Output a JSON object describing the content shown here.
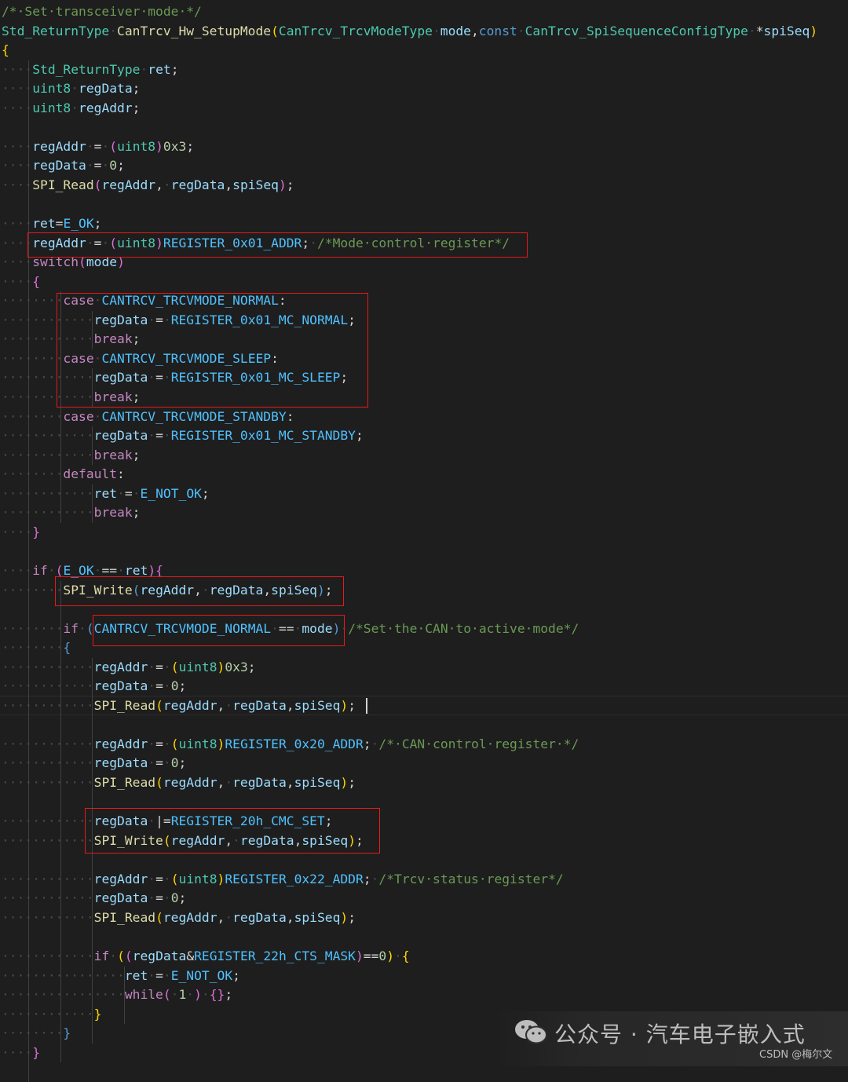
{
  "editor": {
    "language": "c",
    "lines": [
      [
        [
          "cm",
          "/*·Set·transceiver·mode·*/"
        ]
      ],
      [
        [
          "ty",
          "Std_ReturnType"
        ],
        [
          "ws",
          "·"
        ],
        [
          "fn",
          "CanTrcv_Hw_SetupMode"
        ],
        [
          "br",
          "("
        ],
        [
          "ty",
          "CanTrcv_TrcvModeType"
        ],
        [
          "ws",
          "·"
        ],
        [
          "vr",
          "mode"
        ],
        [
          "op",
          ","
        ],
        [
          "kw",
          "const"
        ],
        [
          "ws",
          "·"
        ],
        [
          "ty",
          "CanTrcv_SpiSequenceConfigType"
        ],
        [
          "ws",
          "·"
        ],
        [
          "op",
          "*"
        ],
        [
          "vr",
          "spiSeq"
        ],
        [
          "br",
          ")"
        ]
      ],
      [
        [
          "br",
          "{"
        ]
      ],
      [
        [
          "ws",
          "····"
        ],
        [
          "ty",
          "Std_ReturnType"
        ],
        [
          "ws",
          "·"
        ],
        [
          "vr",
          "ret"
        ],
        [
          "op",
          ";"
        ]
      ],
      [
        [
          "ws",
          "····"
        ],
        [
          "ty",
          "uint8"
        ],
        [
          "ws",
          "·"
        ],
        [
          "vr",
          "regData"
        ],
        [
          "op",
          ";"
        ]
      ],
      [
        [
          "ws",
          "····"
        ],
        [
          "ty",
          "uint8"
        ],
        [
          "ws",
          "·"
        ],
        [
          "vr",
          "regAddr"
        ],
        [
          "op",
          ";"
        ]
      ],
      [],
      [
        [
          "ws",
          "····"
        ],
        [
          "vr",
          "regAddr"
        ],
        [
          "ws",
          "·"
        ],
        [
          "op",
          "="
        ],
        [
          "ws",
          "·"
        ],
        [
          "pk",
          "("
        ],
        [
          "ty",
          "uint8"
        ],
        [
          "pk",
          ")"
        ],
        [
          "nm",
          "0x3"
        ],
        [
          "op",
          ";"
        ]
      ],
      [
        [
          "ws",
          "····"
        ],
        [
          "vr",
          "regData"
        ],
        [
          "ws",
          "·"
        ],
        [
          "op",
          "="
        ],
        [
          "ws",
          "·"
        ],
        [
          "nm",
          "0"
        ],
        [
          "op",
          ";"
        ]
      ],
      [
        [
          "ws",
          "····"
        ],
        [
          "fn",
          "SPI_Read"
        ],
        [
          "pk",
          "("
        ],
        [
          "vr",
          "regAddr"
        ],
        [
          "op",
          ","
        ],
        [
          "ws",
          "·"
        ],
        [
          "vr",
          "regData"
        ],
        [
          "op",
          ","
        ],
        [
          "vr",
          "spiSeq"
        ],
        [
          "pk",
          ")"
        ],
        [
          "op",
          ";"
        ]
      ],
      [],
      [
        [
          "ws",
          "····"
        ],
        [
          "vr",
          "ret"
        ],
        [
          "op",
          "="
        ],
        [
          "mc",
          "E_OK"
        ],
        [
          "op",
          ";"
        ]
      ],
      [
        [
          "ws",
          "····"
        ],
        [
          "vr",
          "regAddr"
        ],
        [
          "ws",
          "·"
        ],
        [
          "op",
          "="
        ],
        [
          "ws",
          "·"
        ],
        [
          "pk",
          "("
        ],
        [
          "ty",
          "uint8"
        ],
        [
          "pk",
          ")"
        ],
        [
          "mc",
          "REGISTER_0x01_ADDR"
        ],
        [
          "op",
          ";"
        ],
        [
          "ws",
          "·"
        ],
        [
          "cm",
          "/*Mode·control·register*/"
        ]
      ],
      [
        [
          "ws",
          "····"
        ],
        [
          "ct",
          "switch"
        ],
        [
          "pk",
          "("
        ],
        [
          "vr",
          "mode"
        ],
        [
          "pk",
          ")"
        ]
      ],
      [
        [
          "ws",
          "····"
        ],
        [
          "pk",
          "{"
        ]
      ],
      [
        [
          "ws",
          "········"
        ],
        [
          "ct",
          "case"
        ],
        [
          "ws",
          "·"
        ],
        [
          "mc",
          "CANTRCV_TRCVMODE_NORMAL"
        ],
        [
          "op",
          ":"
        ]
      ],
      [
        [
          "ws",
          "············"
        ],
        [
          "vr",
          "regData"
        ],
        [
          "ws",
          "·"
        ],
        [
          "op",
          "="
        ],
        [
          "ws",
          "·"
        ],
        [
          "mc",
          "REGISTER_0x01_MC_NORMAL"
        ],
        [
          "op",
          ";"
        ]
      ],
      [
        [
          "ws",
          "············"
        ],
        [
          "ct",
          "break"
        ],
        [
          "op",
          ";"
        ]
      ],
      [
        [
          "ws",
          "········"
        ],
        [
          "ct",
          "case"
        ],
        [
          "ws",
          "·"
        ],
        [
          "mc",
          "CANTRCV_TRCVMODE_SLEEP"
        ],
        [
          "op",
          ":"
        ]
      ],
      [
        [
          "ws",
          "············"
        ],
        [
          "vr",
          "regData"
        ],
        [
          "ws",
          "·"
        ],
        [
          "op",
          "="
        ],
        [
          "ws",
          "·"
        ],
        [
          "mc",
          "REGISTER_0x01_MC_SLEEP"
        ],
        [
          "op",
          ";"
        ]
      ],
      [
        [
          "ws",
          "············"
        ],
        [
          "ct",
          "break"
        ],
        [
          "op",
          ";"
        ]
      ],
      [
        [
          "ws",
          "········"
        ],
        [
          "ct",
          "case"
        ],
        [
          "ws",
          "·"
        ],
        [
          "mc",
          "CANTRCV_TRCVMODE_STANDBY"
        ],
        [
          "op",
          ":"
        ]
      ],
      [
        [
          "ws",
          "············"
        ],
        [
          "vr",
          "regData"
        ],
        [
          "ws",
          "·"
        ],
        [
          "op",
          "="
        ],
        [
          "ws",
          "·"
        ],
        [
          "mc",
          "REGISTER_0x01_MC_STANDBY"
        ],
        [
          "op",
          ";"
        ]
      ],
      [
        [
          "ws",
          "············"
        ],
        [
          "ct",
          "break"
        ],
        [
          "op",
          ";"
        ]
      ],
      [
        [
          "ws",
          "········"
        ],
        [
          "ct",
          "default"
        ],
        [
          "op",
          ":"
        ]
      ],
      [
        [
          "ws",
          "············"
        ],
        [
          "vr",
          "ret"
        ],
        [
          "ws",
          "·"
        ],
        [
          "op",
          "="
        ],
        [
          "ws",
          "·"
        ],
        [
          "mc",
          "E_NOT_OK"
        ],
        [
          "op",
          ";"
        ]
      ],
      [
        [
          "ws",
          "············"
        ],
        [
          "ct",
          "break"
        ],
        [
          "op",
          ";"
        ]
      ],
      [
        [
          "ws",
          "····"
        ],
        [
          "pk",
          "}"
        ]
      ],
      [],
      [
        [
          "ws",
          "····"
        ],
        [
          "ct",
          "if"
        ],
        [
          "ws",
          "·"
        ],
        [
          "pk",
          "("
        ],
        [
          "mc",
          "E_OK"
        ],
        [
          "ws",
          "·"
        ],
        [
          "op",
          "=="
        ],
        [
          "ws",
          "·"
        ],
        [
          "vr",
          "ret"
        ],
        [
          "pk",
          ")"
        ],
        [
          "pk",
          "{"
        ]
      ],
      [
        [
          "ws",
          "········"
        ],
        [
          "fn",
          "SPI_Write"
        ],
        [
          "kw",
          "("
        ],
        [
          "vr",
          "regAddr"
        ],
        [
          "op",
          ","
        ],
        [
          "ws",
          "·"
        ],
        [
          "vr",
          "regData"
        ],
        [
          "op",
          ","
        ],
        [
          "vr",
          "spiSeq"
        ],
        [
          "kw",
          ")"
        ],
        [
          "op",
          ";"
        ]
      ],
      [],
      [
        [
          "ws",
          "········"
        ],
        [
          "ct",
          "if"
        ],
        [
          "ws",
          "·"
        ],
        [
          "kw",
          "("
        ],
        [
          "mc",
          "CANTRCV_TRCVMODE_NORMAL"
        ],
        [
          "ws",
          "·"
        ],
        [
          "op",
          "=="
        ],
        [
          "ws",
          "·"
        ],
        [
          "vr",
          "mode"
        ],
        [
          "kw",
          ")"
        ],
        [
          "ws",
          "·"
        ],
        [
          "cm",
          "/*Set·the·CAN·to·active·mode*/"
        ]
      ],
      [
        [
          "ws",
          "········"
        ],
        [
          "kw",
          "{"
        ]
      ],
      [
        [
          "ws",
          "············"
        ],
        [
          "vr",
          "regAddr"
        ],
        [
          "ws",
          "·"
        ],
        [
          "op",
          "="
        ],
        [
          "ws",
          "·"
        ],
        [
          "br",
          "("
        ],
        [
          "ty",
          "uint8"
        ],
        [
          "br",
          ")"
        ],
        [
          "nm",
          "0x3"
        ],
        [
          "op",
          ";"
        ]
      ],
      [
        [
          "ws",
          "············"
        ],
        [
          "vr",
          "regData"
        ],
        [
          "ws",
          "·"
        ],
        [
          "op",
          "="
        ],
        [
          "ws",
          "·"
        ],
        [
          "nm",
          "0"
        ],
        [
          "op",
          ";"
        ]
      ],
      [
        [
          "ws",
          "············"
        ],
        [
          "fn",
          "SPI_Read"
        ],
        [
          "br",
          "("
        ],
        [
          "vr",
          "regAddr"
        ],
        [
          "op",
          ","
        ],
        [
          "ws",
          "·"
        ],
        [
          "vr",
          "regData"
        ],
        [
          "op",
          ","
        ],
        [
          "vr",
          "spiSeq"
        ],
        [
          "br",
          ")"
        ],
        [
          "op",
          ";"
        ]
      ],
      [],
      [
        [
          "ws",
          "············"
        ],
        [
          "vr",
          "regAddr"
        ],
        [
          "ws",
          "·"
        ],
        [
          "op",
          "="
        ],
        [
          "ws",
          "·"
        ],
        [
          "br",
          "("
        ],
        [
          "ty",
          "uint8"
        ],
        [
          "br",
          ")"
        ],
        [
          "mc",
          "REGISTER_0x20_ADDR"
        ],
        [
          "op",
          ";"
        ],
        [
          "ws",
          "·"
        ],
        [
          "cm",
          "/*·CAN·control·register·*/"
        ]
      ],
      [
        [
          "ws",
          "············"
        ],
        [
          "vr",
          "regData"
        ],
        [
          "ws",
          "·"
        ],
        [
          "op",
          "="
        ],
        [
          "ws",
          "·"
        ],
        [
          "nm",
          "0"
        ],
        [
          "op",
          ";"
        ]
      ],
      [
        [
          "ws",
          "············"
        ],
        [
          "fn",
          "SPI_Read"
        ],
        [
          "br",
          "("
        ],
        [
          "vr",
          "regAddr"
        ],
        [
          "op",
          ","
        ],
        [
          "ws",
          "·"
        ],
        [
          "vr",
          "regData"
        ],
        [
          "op",
          ","
        ],
        [
          "vr",
          "spiSeq"
        ],
        [
          "br",
          ")"
        ],
        [
          "op",
          ";"
        ]
      ],
      [],
      [
        [
          "ws",
          "············"
        ],
        [
          "vr",
          "regData"
        ],
        [
          "ws",
          "·"
        ],
        [
          "op",
          "|="
        ],
        [
          "mc",
          "REGISTER_20h_CMC_SET"
        ],
        [
          "op",
          ";"
        ]
      ],
      [
        [
          "ws",
          "············"
        ],
        [
          "fn",
          "SPI_Write"
        ],
        [
          "br",
          "("
        ],
        [
          "vr",
          "regAddr"
        ],
        [
          "op",
          ","
        ],
        [
          "ws",
          "·"
        ],
        [
          "vr",
          "regData"
        ],
        [
          "op",
          ","
        ],
        [
          "vr",
          "spiSeq"
        ],
        [
          "br",
          ")"
        ],
        [
          "op",
          ";"
        ]
      ],
      [],
      [
        [
          "ws",
          "············"
        ],
        [
          "vr",
          "regAddr"
        ],
        [
          "ws",
          "·"
        ],
        [
          "op",
          "="
        ],
        [
          "ws",
          "·"
        ],
        [
          "br",
          "("
        ],
        [
          "ty",
          "uint8"
        ],
        [
          "br",
          ")"
        ],
        [
          "mc",
          "REGISTER_0x22_ADDR"
        ],
        [
          "op",
          ";"
        ],
        [
          "ws",
          "·"
        ],
        [
          "cm",
          "/*Trcv·status·register*/"
        ]
      ],
      [
        [
          "ws",
          "············"
        ],
        [
          "vr",
          "regData"
        ],
        [
          "ws",
          "·"
        ],
        [
          "op",
          "="
        ],
        [
          "ws",
          "·"
        ],
        [
          "nm",
          "0"
        ],
        [
          "op",
          ";"
        ]
      ],
      [
        [
          "ws",
          "············"
        ],
        [
          "fn",
          "SPI_Read"
        ],
        [
          "br",
          "("
        ],
        [
          "vr",
          "regAddr"
        ],
        [
          "op",
          ","
        ],
        [
          "ws",
          "·"
        ],
        [
          "vr",
          "regData"
        ],
        [
          "op",
          ","
        ],
        [
          "vr",
          "spiSeq"
        ],
        [
          "br",
          ")"
        ],
        [
          "op",
          ";"
        ]
      ],
      [],
      [
        [
          "ws",
          "············"
        ],
        [
          "ct",
          "if"
        ],
        [
          "ws",
          "·"
        ],
        [
          "br",
          "("
        ],
        [
          "pk",
          "("
        ],
        [
          "vr",
          "regData"
        ],
        [
          "op",
          "&"
        ],
        [
          "mc",
          "REGISTER_22h_CTS_MASK"
        ],
        [
          "pk",
          ")"
        ],
        [
          "op",
          "=="
        ],
        [
          "nm",
          "0"
        ],
        [
          "br",
          ")"
        ],
        [
          "ws",
          "·"
        ],
        [
          "br",
          "{"
        ]
      ],
      [
        [
          "ws",
          "················"
        ],
        [
          "vr",
          "ret"
        ],
        [
          "ws",
          "·"
        ],
        [
          "op",
          "="
        ],
        [
          "ws",
          "·"
        ],
        [
          "mc",
          "E_NOT_OK"
        ],
        [
          "op",
          ";"
        ]
      ],
      [
        [
          "ws",
          "················"
        ],
        [
          "ct",
          "while"
        ],
        [
          "pk",
          "("
        ],
        [
          "ws",
          "·"
        ],
        [
          "nm",
          "1"
        ],
        [
          "ws",
          "·"
        ],
        [
          "pk",
          ")"
        ],
        [
          "ws",
          "·"
        ],
        [
          "pk",
          "{"
        ],
        [
          "pk",
          "}"
        ],
        [
          "op",
          ";"
        ]
      ],
      [
        [
          "ws",
          "············"
        ],
        [
          "br",
          "}"
        ]
      ],
      [
        [
          "ws",
          "········"
        ],
        [
          "kw",
          "}"
        ]
      ],
      [
        [
          "ws",
          "····"
        ],
        [
          "pk",
          "}"
        ]
      ]
    ]
  },
  "watermark": {
    "text": "公众号 · 汽车电子嵌入式",
    "icon": "wechat-icon",
    "credit": "CSDN @梅尔文"
  },
  "colors": {
    "background": "#1e1e1e",
    "highlight_box": "#e51a1a"
  }
}
